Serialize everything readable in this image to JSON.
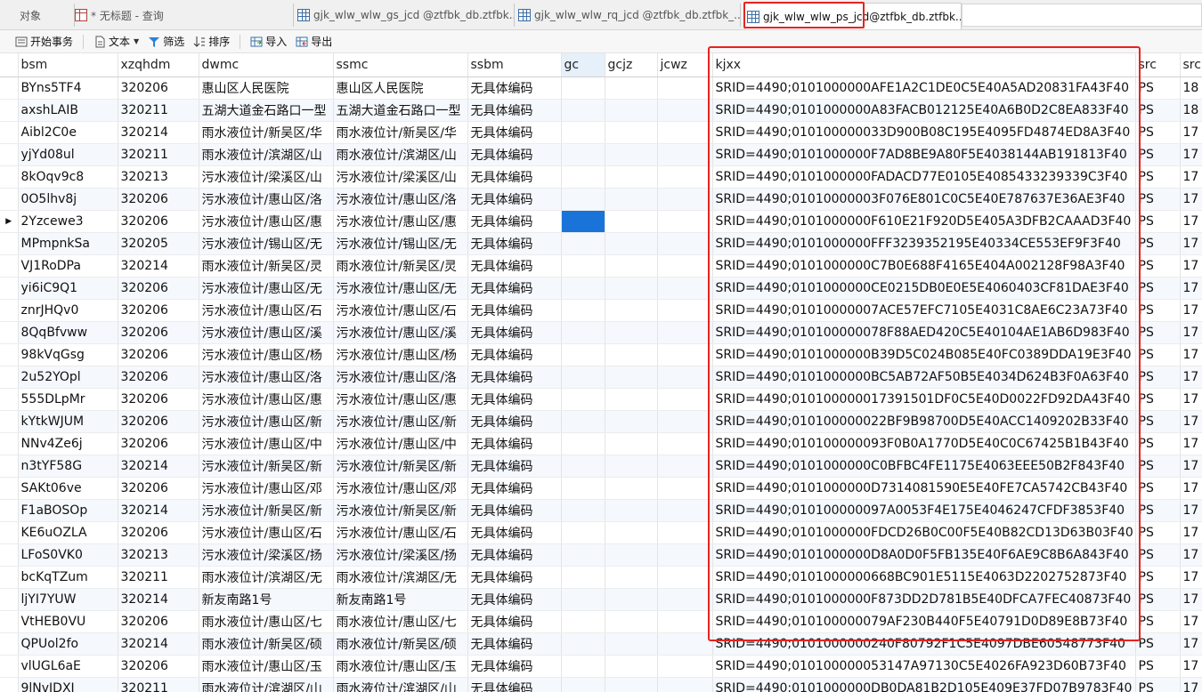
{
  "tabs": {
    "objects": "对象",
    "query": "* 无标题 - 查询",
    "gs": "gjk_wlw_wlw_gs_jcd @ztfbk_db.ztfbk...",
    "rq": "gjk_wlw_wlw_rq_jcd @ztfbk_db.ztfbk_...",
    "ps_name": "gjk_wlw_wlw_ps_jcd",
    "ps_rest": " @ztfbk_db.ztfbk..."
  },
  "toolbar": {
    "begin": "开始事务",
    "text": "文本",
    "filter": "筛选",
    "sort": "排序",
    "import": "导入",
    "export": "导出"
  },
  "columns": [
    "bsm",
    "xzqhdm",
    "dwmc",
    "ssmc",
    "ssbm",
    "gc",
    "gcjz",
    "jcwz",
    "kjxx",
    "src",
    "src"
  ],
  "rows": [
    [
      "BYns5TF4",
      "320206",
      "惠山区人民医院",
      "惠山区人民医院",
      "无具体编码",
      "",
      "",
      "",
      "SRID=4490;0101000000AFE1A2C1DE0C5E40A5AD20831FA43F40",
      "PS",
      "18"
    ],
    [
      "axshLAIB",
      "320211",
      "五湖大道金石路口一型",
      "五湖大道金石路口一型",
      "无具体编码",
      "",
      "",
      "",
      "SRID=4490;0101000000A83FACB012125E40A6B0D2C8EA833F40",
      "PS",
      "18"
    ],
    [
      "Aibl2C0e",
      "320214",
      "雨水液位计/新吴区/华",
      "雨水液位计/新吴区/华",
      "无具体编码",
      "",
      "",
      "",
      "SRID=4490;010100000033D900B08C195E4095FD4874ED8A3F40",
      "PS",
      "17"
    ],
    [
      "yjYd08ul",
      "320211",
      "雨水液位计/滨湖区/山",
      "雨水液位计/滨湖区/山",
      "无具体编码",
      "",
      "",
      "",
      "SRID=4490;0101000000F7AD8BE9A80F5E4038144AB191813F40",
      "PS",
      "17"
    ],
    [
      "8kOqv9c8",
      "320213",
      "污水液位计/梁溪区/山",
      "污水液位计/梁溪区/山",
      "无具体编码",
      "",
      "",
      "",
      "SRID=4490;0101000000FADACD77E0105E4085433239339C3F40",
      "PS",
      "17"
    ],
    [
      "0O5lhv8j",
      "320206",
      "污水液位计/惠山区/洛",
      "污水液位计/惠山区/洛",
      "无具体编码",
      "",
      "",
      "",
      "SRID=4490;01010000003F076E801C0C5E40E787637E36AE3F40",
      "PS",
      "17"
    ],
    [
      "2Yzcewe3",
      "320206",
      "污水液位计/惠山区/惠",
      "污水液位计/惠山区/惠",
      "无具体编码",
      "",
      "",
      "",
      "SRID=4490;0101000000F610E21F920D5E405A3DFB2CAAAD3F40",
      "PS",
      "17"
    ],
    [
      "MPmpnkSa",
      "320205",
      "污水液位计/锡山区/无",
      "污水液位计/锡山区/无",
      "无具体编码",
      "",
      "",
      "",
      "SRID=4490;0101000000FFF3239352195E40334CE553EF9F3F40",
      "PS",
      "17"
    ],
    [
      "VJ1RoDPa",
      "320214",
      "雨水液位计/新吴区/灵",
      "雨水液位计/新吴区/灵",
      "无具体编码",
      "",
      "",
      "",
      "SRID=4490;0101000000C7B0E688F4165E404A002128F98A3F40",
      "PS",
      "17"
    ],
    [
      "yi6iC9Q1",
      "320206",
      "污水液位计/惠山区/无",
      "污水液位计/惠山区/无",
      "无具体编码",
      "",
      "",
      "",
      "SRID=4490;0101000000CE0215DB0E0E5E4060403CF81DAE3F40",
      "PS",
      "17"
    ],
    [
      "znrJHQv0",
      "320206",
      "污水液位计/惠山区/石",
      "污水液位计/惠山区/石",
      "无具体编码",
      "",
      "",
      "",
      "SRID=4490;01010000007ACE57EFC7105E4031C8AE6C23A73F40",
      "PS",
      "17"
    ],
    [
      "8QqBfvww",
      "320206",
      "污水液位计/惠山区/溪",
      "污水液位计/惠山区/溪",
      "无具体编码",
      "",
      "",
      "",
      "SRID=4490;010100000078F88AED420C5E40104AE1AB6D983F40",
      "PS",
      "17"
    ],
    [
      "98kVqGsg",
      "320206",
      "污水液位计/惠山区/杨",
      "污水液位计/惠山区/杨",
      "无具体编码",
      "",
      "",
      "",
      "SRID=4490;0101000000B39D5C024B085E40FC0389DDA19E3F40",
      "PS",
      "17"
    ],
    [
      "2u52YOpl",
      "320206",
      "污水液位计/惠山区/洛",
      "污水液位计/惠山区/洛",
      "无具体编码",
      "",
      "",
      "",
      "SRID=4490;0101000000BC5AB72AF50B5E4034D624B3F0A63F40",
      "PS",
      "17"
    ],
    [
      "555DLpMr",
      "320206",
      "污水液位计/惠山区/惠",
      "污水液位计/惠山区/惠",
      "无具体编码",
      "",
      "",
      "",
      "SRID=4490;010100000017391501DF0C5E40D0022FD92DA43F40",
      "PS",
      "17"
    ],
    [
      "kYtkWJUM",
      "320206",
      "污水液位计/惠山区/新",
      "污水液位计/惠山区/新",
      "无具体编码",
      "",
      "",
      "",
      "SRID=4490;010100000022BF9B98700D5E40ACC1409202B33F40",
      "PS",
      "17"
    ],
    [
      "NNv4Ze6j",
      "320206",
      "污水液位计/惠山区/中",
      "污水液位计/惠山区/中",
      "无具体编码",
      "",
      "",
      "",
      "SRID=4490;010100000093F0B0A1770D5E40C0C67425B1B43F40",
      "PS",
      "17"
    ],
    [
      "n3tYF58G",
      "320214",
      "污水液位计/新吴区/新",
      "污水液位计/新吴区/新",
      "无具体编码",
      "",
      "",
      "",
      "SRID=4490;0101000000C0BFBC4FE1175E4063EEE50B2F843F40",
      "PS",
      "17"
    ],
    [
      "SAKt06ve",
      "320206",
      "污水液位计/惠山区/邓",
      "污水液位计/惠山区/邓",
      "无具体编码",
      "",
      "",
      "",
      "SRID=4490;0101000000D7314081590E5E40FE7CA5742CB43F40",
      "PS",
      "17"
    ],
    [
      "F1aBOSOp",
      "320214",
      "污水液位计/新吴区/新",
      "污水液位计/新吴区/新",
      "无具体编码",
      "",
      "",
      "",
      "SRID=4490;010100000097A0053F4E175E4046247CFDF3853F40",
      "PS",
      "17"
    ],
    [
      "KE6uOZLA",
      "320206",
      "污水液位计/惠山区/石",
      "污水液位计/惠山区/石",
      "无具体编码",
      "",
      "",
      "",
      "SRID=4490;0101000000FDCD26B0C00F5E40B82CD13D63B03F40",
      "PS",
      "17"
    ],
    [
      "LFoS0VK0",
      "320213",
      "污水液位计/梁溪区/扬",
      "污水液位计/梁溪区/扬",
      "无具体编码",
      "",
      "",
      "",
      "SRID=4490;0101000000D8A0D0F5FB135E40F6AE9C8B6A843F40",
      "PS",
      "17"
    ],
    [
      "bcKqTZum",
      "320211",
      "雨水液位计/滨湖区/无",
      "雨水液位计/滨湖区/无",
      "无具体编码",
      "",
      "",
      "",
      "SRID=4490;0101000000668BC901E5115E4063D2202752873F40",
      "PS",
      "17"
    ],
    [
      "ljYI7YUW",
      "320214",
      "新友南路1号",
      "新友南路1号",
      "无具体编码",
      "",
      "",
      "",
      "SRID=4490;0101000000F873DD2D781B5E40DFCA7FEC40873F40",
      "PS",
      "17"
    ],
    [
      "VtHEB0VU",
      "320206",
      "雨水液位计/惠山区/七",
      "雨水液位计/惠山区/七",
      "无具体编码",
      "",
      "",
      "",
      "SRID=4490;010100000079AF230B440F5E40791D0D89E8B73F40",
      "PS",
      "17"
    ],
    [
      "QPUol2fo",
      "320214",
      "雨水液位计/新吴区/硕",
      "雨水液位计/新吴区/硕",
      "无具体编码",
      "",
      "",
      "",
      "SRID=4490;0101000000240F80792F1C5E4097DBE60548773F40",
      "PS",
      "17"
    ],
    [
      "vlUGL6aE",
      "320206",
      "雨水液位计/惠山区/玉",
      "雨水液位计/惠山区/玉",
      "无具体编码",
      "",
      "",
      "",
      "SRID=4490;010100000053147A97130C5E4026FA923D60B73F40",
      "PS",
      "17"
    ],
    [
      "9lNvJDXI",
      "320211",
      "雨水液位计/滨湖区/山",
      "雨水液位计/滨湖区/山",
      "无具体编码",
      "",
      "",
      "",
      "SRID=4490;0101000000DB0DA81B2D105E409E37FD07B9783F40",
      "PS",
      "17"
    ]
  ],
  "current_row": 6,
  "selected_col": 5,
  "colors": {
    "highlight": "#e8231e",
    "selection": "#1a73d9"
  }
}
